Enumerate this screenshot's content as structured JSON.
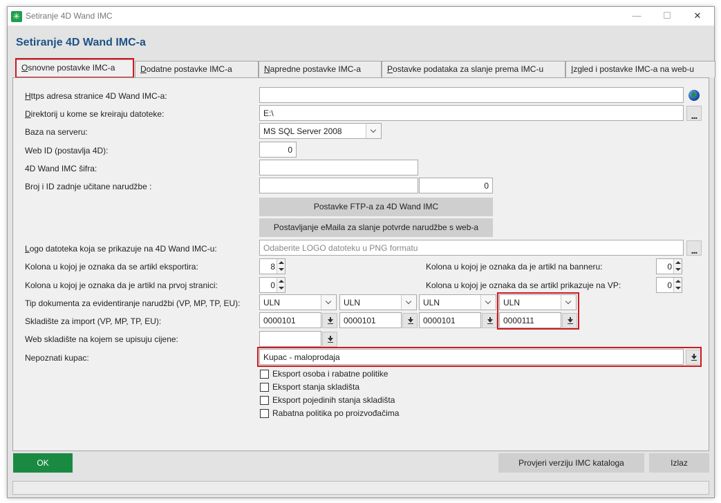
{
  "window": {
    "title": "Setiranje 4D Wand IMC",
    "controls": {
      "minimize": "—",
      "maximize": "☐",
      "close": "✕"
    }
  },
  "header": {
    "title": "Setiranje 4D Wand IMC-a"
  },
  "tabs": [
    {
      "accel": "O",
      "rest": "snovne postavke IMC-a",
      "active": true
    },
    {
      "accel": "D",
      "rest": "odatne postavke IMC-a",
      "active": false
    },
    {
      "accel": "N",
      "rest": "apredne postavke IMC-a",
      "active": false
    },
    {
      "accel": "P",
      "rest": "ostavke podataka za slanje prema IMC-u",
      "active": false
    },
    {
      "accel": "I",
      "rest": "zgled i postavke IMC-a na web-u",
      "active": false
    }
  ],
  "form": {
    "https_label_accel": "H",
    "https_label_rest": "ttps adresa stranice 4D Wand IMC-a:",
    "https_value": "",
    "dir_label_accel": "D",
    "dir_label_rest": "irektorij u kome se kreiraju datoteke:",
    "dir_value": "E:\\",
    "baza_label": "Baza na serveru:",
    "baza_value": "MS SQL Server 2008",
    "webid_label": "Web ID (postavlja 4D):",
    "webid_value": "0",
    "sifra_label": "4D Wand IMC šifra:",
    "sifra_value": "",
    "broj_label": "Broj i ID zadnje učitane narudžbe :",
    "broj_value": "",
    "id_value": "0",
    "ftp_button": "Postavke FTP-a za 4D Wand IMC",
    "email_button": "Postavljanje eMaila za slanje potvrde narudžbe s web-a",
    "logo_label_accel": "L",
    "logo_label_rest": "ogo datoteka koja se prikazuje na 4D Wand IMC-u:",
    "logo_placeholder": "Odaberite LOGO datoteku u PNG formatu",
    "kolona_eksport_label": "Kolona u kojoj je oznaka da se artikl eksportira:",
    "kolona_eksport_value": "8",
    "kolona_prva_label": "Kolona u kojoj je oznaka da je artikl na prvoj stranici:",
    "kolona_prva_value": "0",
    "kolona_banner_label": "Kolona u kojoj je oznaka da je artikl na banneru:",
    "kolona_banner_value": "0",
    "kolona_vp_label": "Kolona u kojoj je oznaka da se artikl prikazuje na VP:",
    "kolona_vp_value": "0",
    "tip_label": "Tip dokumenta za evidentiranje narudžbi (VP, MP, TP, EU):",
    "tip_values": [
      "ULN",
      "ULN",
      "ULN",
      "ULN"
    ],
    "skladiste_label": "Skladište za import (VP, MP, TP, EU):",
    "skladiste_values": [
      "0000101",
      "0000101",
      "0000101",
      "0000111"
    ],
    "web_skladiste_label": "Web skladište na kojem se upisuju cijene:",
    "web_skladiste_value": "",
    "kupac_label": "Nepoznati kupac:",
    "kupac_value": "Kupac - maloprodaja",
    "checkboxes": [
      {
        "label": "Eksport osoba i rabatne politike",
        "checked": false
      },
      {
        "label": "Eksport stanja skladišta",
        "checked": false
      },
      {
        "label": "Eksport pojedinih stanja skladišta",
        "checked": false
      },
      {
        "label": "Rabatna politika po proizvođačima",
        "checked": false
      }
    ]
  },
  "footer": {
    "ok": "OK",
    "check_version": "Provjeri verziju IMC kataloga",
    "exit": "Izlaz"
  },
  "colors": {
    "accent_title": "#1d5386",
    "ok_green": "#1a8a43",
    "highlight_red": "#d0181e",
    "app_icon_green": "#1e9e4a"
  },
  "icons": [
    "app-icon",
    "globe-icon",
    "browse-dots-icon",
    "dropdown-arrow-icon",
    "download-arrow-icon",
    "spin-up-icon",
    "spin-down-icon"
  ]
}
